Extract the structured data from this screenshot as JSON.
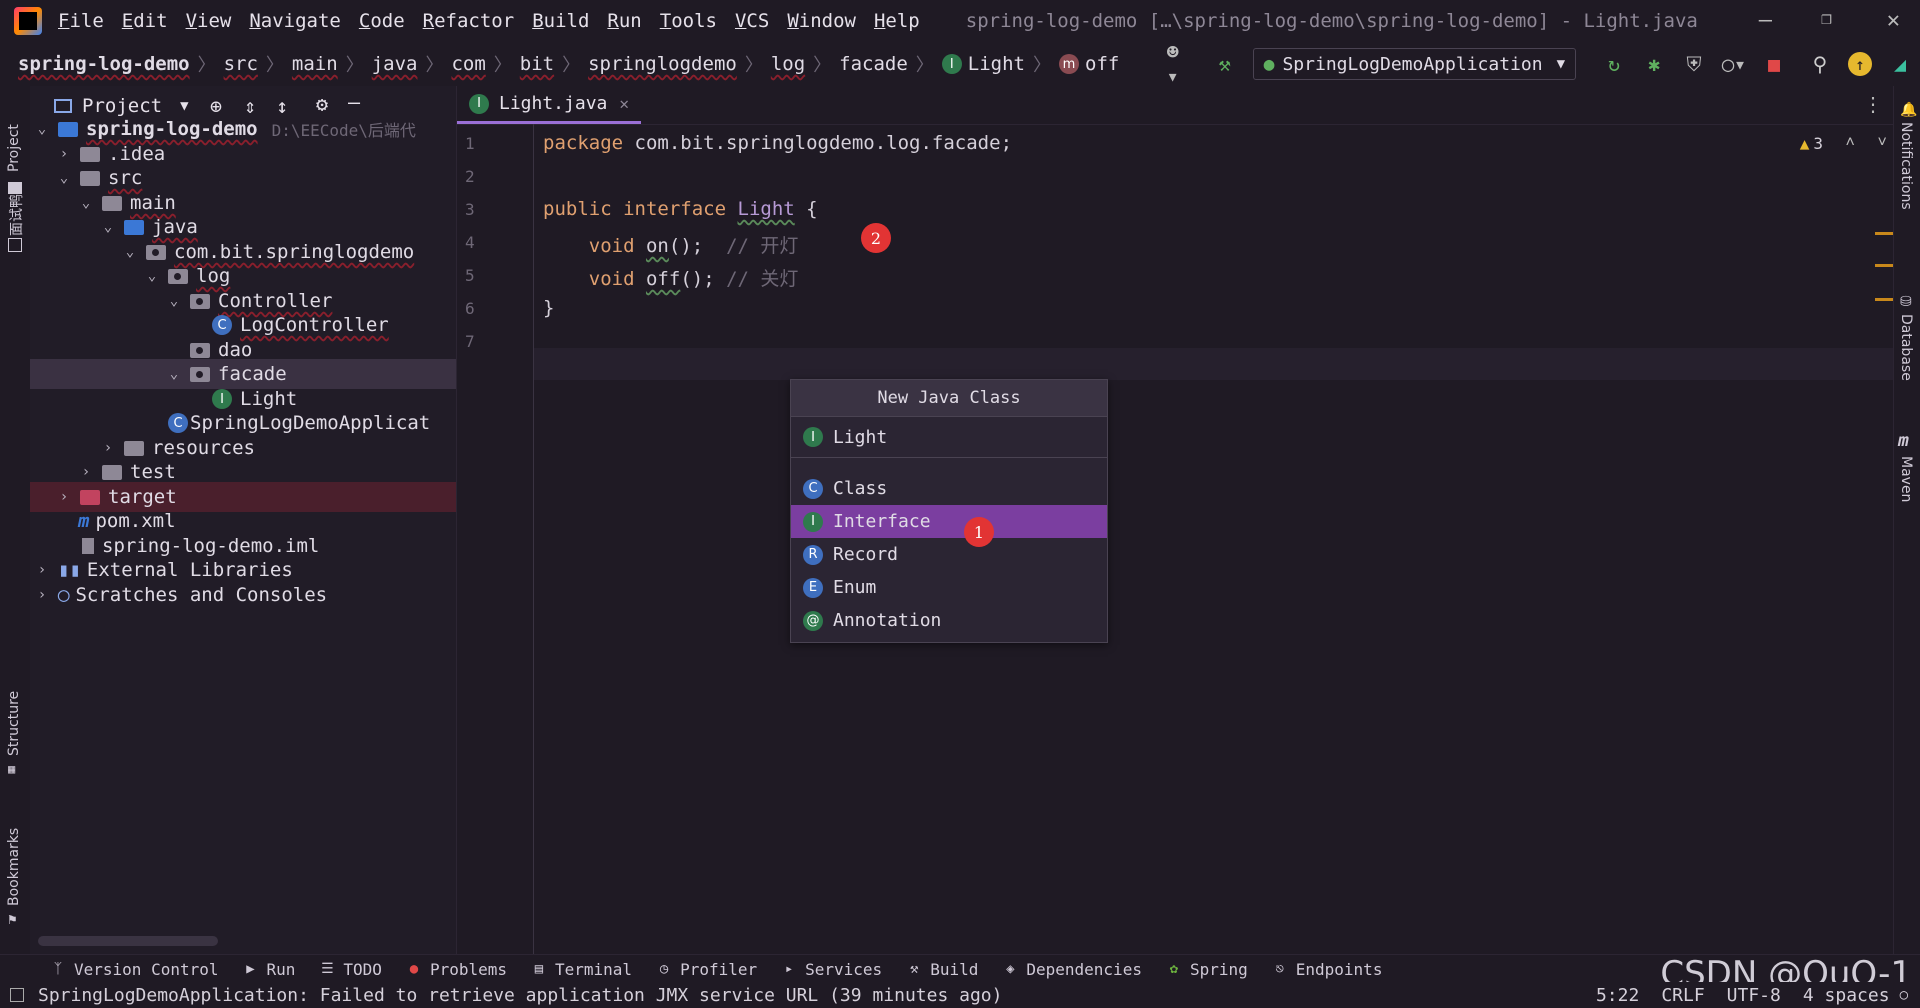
{
  "menu": {
    "items": [
      "File",
      "Edit",
      "View",
      "Navigate",
      "Code",
      "Refactor",
      "Build",
      "Run",
      "Tools",
      "VCS",
      "Window",
      "Help"
    ],
    "window_title": "spring-log-demo […\\spring-log-demo\\spring-log-demo] - Light.java"
  },
  "breadcrumb": {
    "items": [
      "spring-log-demo",
      "src",
      "main",
      "java",
      "com",
      "bit",
      "springlogdemo",
      "log",
      "facade"
    ],
    "class_name": "Light",
    "method_name": "off"
  },
  "toolbar": {
    "run_config": "SpringLogDemoApplication"
  },
  "left_strip": {
    "project": "Project",
    "interview": "面试鸭",
    "structure": "Structure",
    "bookmarks": "Bookmarks"
  },
  "right_strip": {
    "notifications": "Notifications",
    "database": "Database",
    "maven": "Maven"
  },
  "project_panel": {
    "title": "Project",
    "root_name": "spring-log-demo",
    "root_path": "D:\\EECode\\后端代",
    "items": {
      "idea": ".idea",
      "src": "src",
      "main": "main",
      "java": "java",
      "pkg": "com.bit.springlogdemo",
      "log": "log",
      "controller": "Controller",
      "logcontroller": "LogController",
      "dao": "dao",
      "facade": "facade",
      "light": "Light",
      "app": "SpringLogDemoApplicat",
      "resources": "resources",
      "test": "test",
      "target": "target",
      "pom": "pom.xml",
      "iml": "spring-log-demo.iml",
      "extlibs": "External Libraries",
      "scratches": "Scratches and Consoles"
    }
  },
  "editor": {
    "tab_label": "Light.java",
    "warning_count": "3",
    "line_numbers": [
      "1",
      "2",
      "3",
      "4",
      "5",
      "6",
      "7"
    ],
    "code": {
      "l1_kw": "package",
      "l1_rest": " com.bit.springlogdemo.log.facade;",
      "l3_public": "public",
      "l3_interface": "interface",
      "l3_name": "Light",
      "l3_brace": " {",
      "l4_void": "void",
      "l4_method": "on",
      "l4_rest": "();",
      "l4_comment": "  // 开灯",
      "l5_void": "void",
      "l5_method": "off",
      "l5_rest": "();",
      "l5_comment": " // 关灯",
      "l6": "}"
    }
  },
  "popup": {
    "title": "New Java Class",
    "name_value": "Light",
    "options": [
      "Class",
      "Interface",
      "Record",
      "Enum",
      "Annotation"
    ],
    "badges": [
      "C",
      "I",
      "R",
      "E",
      "@"
    ],
    "selected": "Interface"
  },
  "markers": [
    "1",
    "2"
  ],
  "bottom_tabs": [
    "Version Control",
    "Run",
    "TODO",
    "Problems",
    "Terminal",
    "Profiler",
    "Services",
    "Build",
    "Dependencies",
    "Spring",
    "Endpoints"
  ],
  "status": {
    "message": "SpringLogDemoApplication: Failed to retrieve application JMX service URL (39 minutes ago)",
    "position": "5:22",
    "line_sep": "CRLF",
    "encoding": "UTF-8",
    "indent": "4 spaces"
  },
  "watermark": "CSDN @OuO-1"
}
